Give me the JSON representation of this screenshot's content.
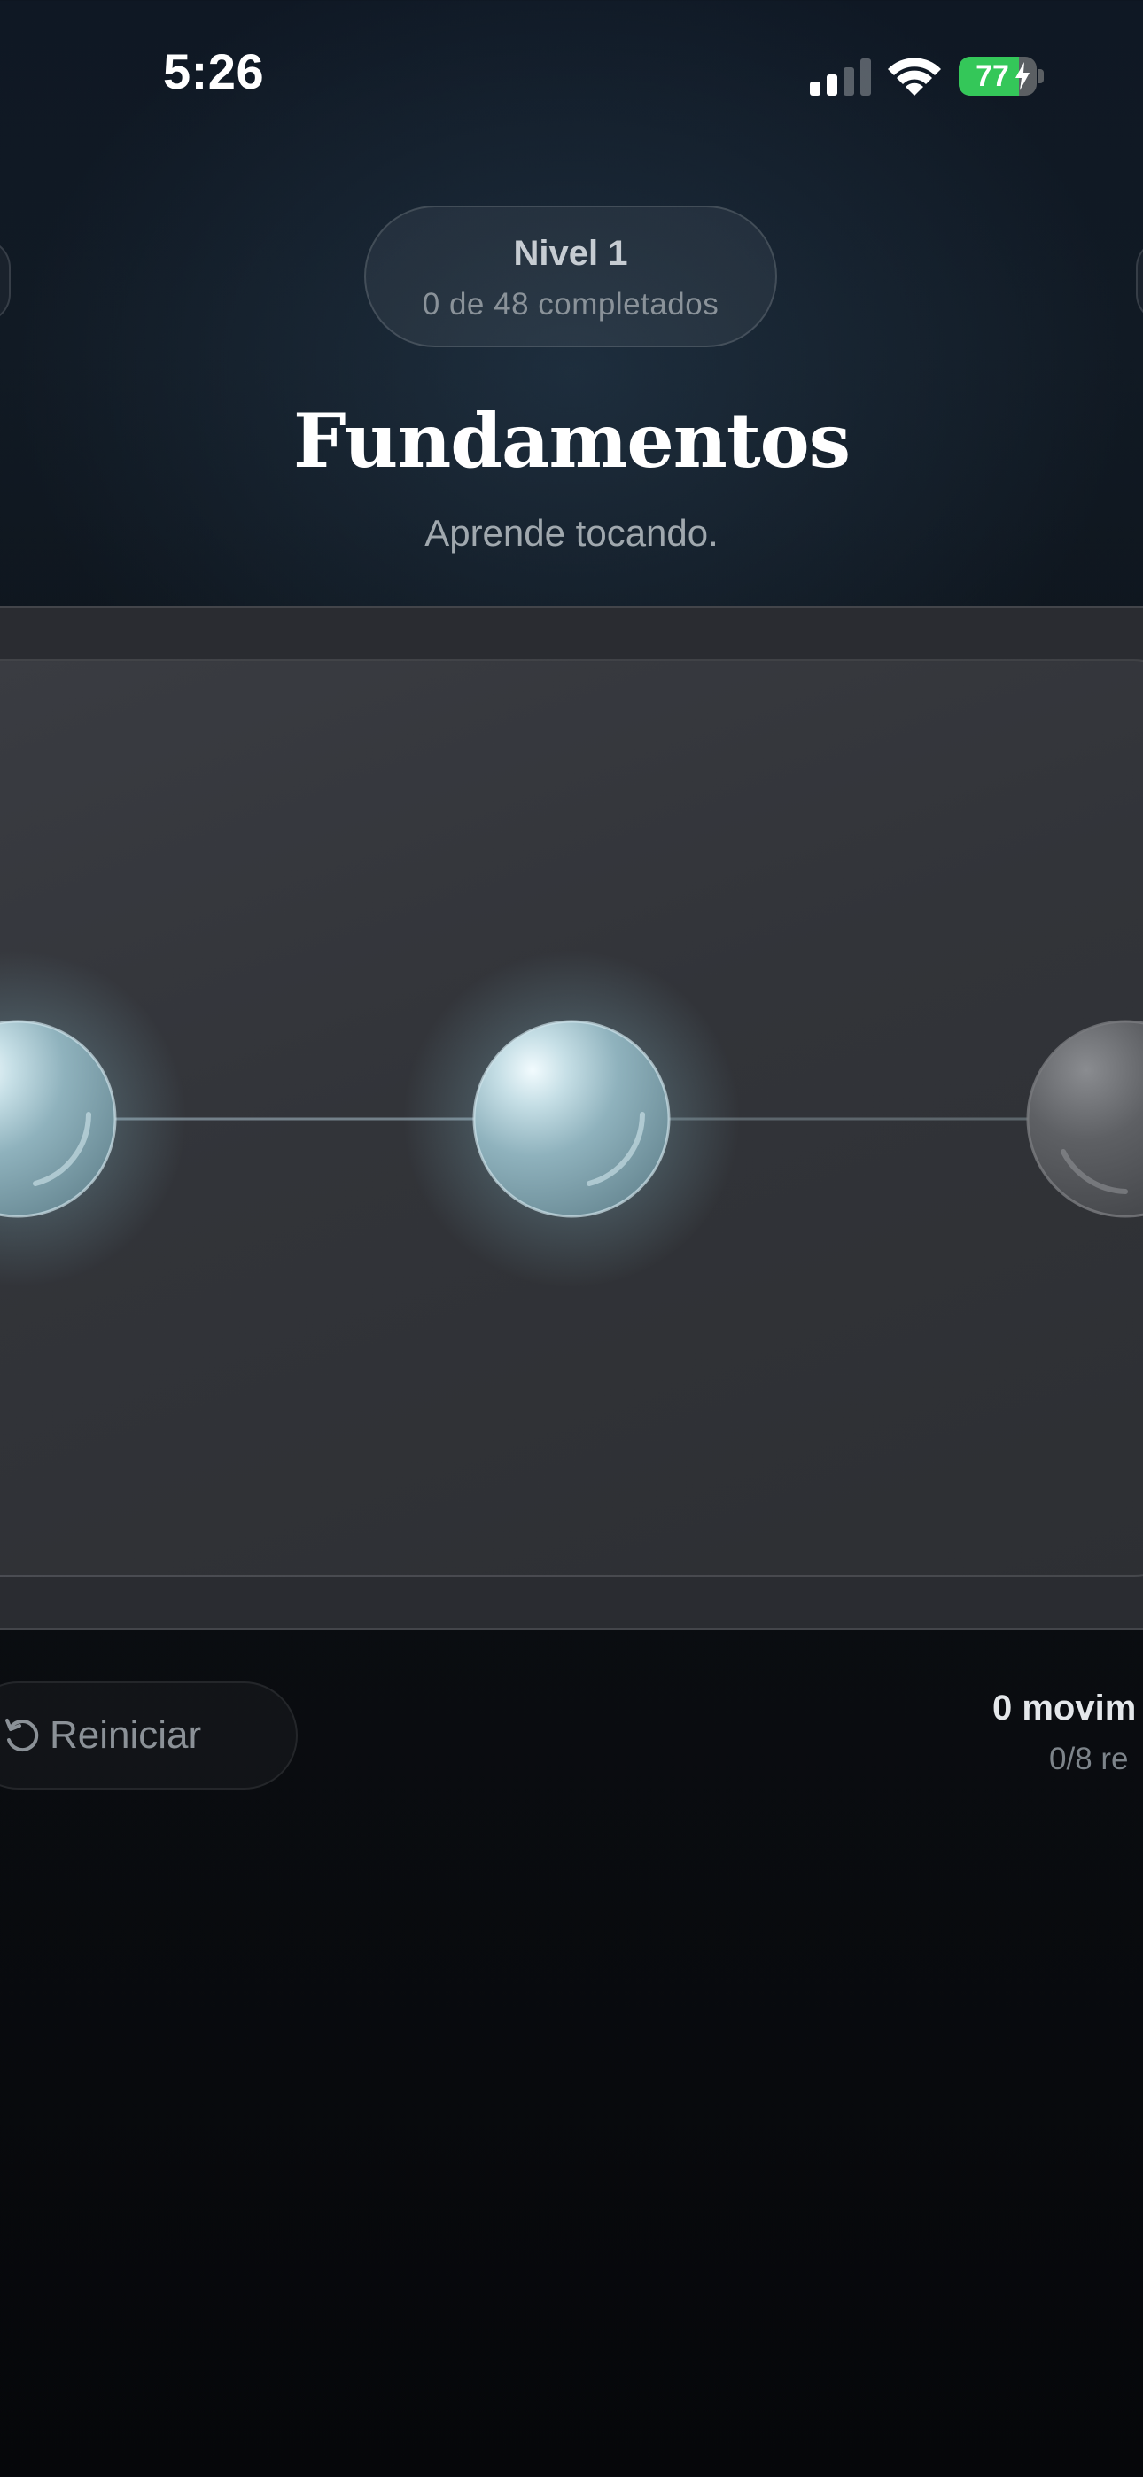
{
  "status_bar": {
    "time": "5:26",
    "battery_level": "77",
    "battery_percent": 77,
    "signal_bars_active": 2,
    "signal_bars_total": 4,
    "icons": [
      "signal-icon",
      "wifi-icon",
      "battery-charging-icon"
    ]
  },
  "level": {
    "title": "Nivel 1",
    "progress": "0 de 48 completados"
  },
  "header": {
    "title": "Fundamentos",
    "subtitle": "Aprende tocando."
  },
  "board": {
    "nodes": [
      {
        "name": "node-left",
        "state": "lit"
      },
      {
        "name": "node-center",
        "state": "lit"
      },
      {
        "name": "node-right",
        "state": "unlit"
      }
    ],
    "colors": {
      "lit": "#8fb2bd",
      "lit_glow": "#bfe3ee",
      "unlit": "#55575b",
      "link": "#8a9aa4"
    }
  },
  "controls": {
    "reset_label": "Reiniciar",
    "reset_icon": "rotate-left-icon",
    "moves": "0 movim",
    "moves_sub": "0/8 re"
  }
}
